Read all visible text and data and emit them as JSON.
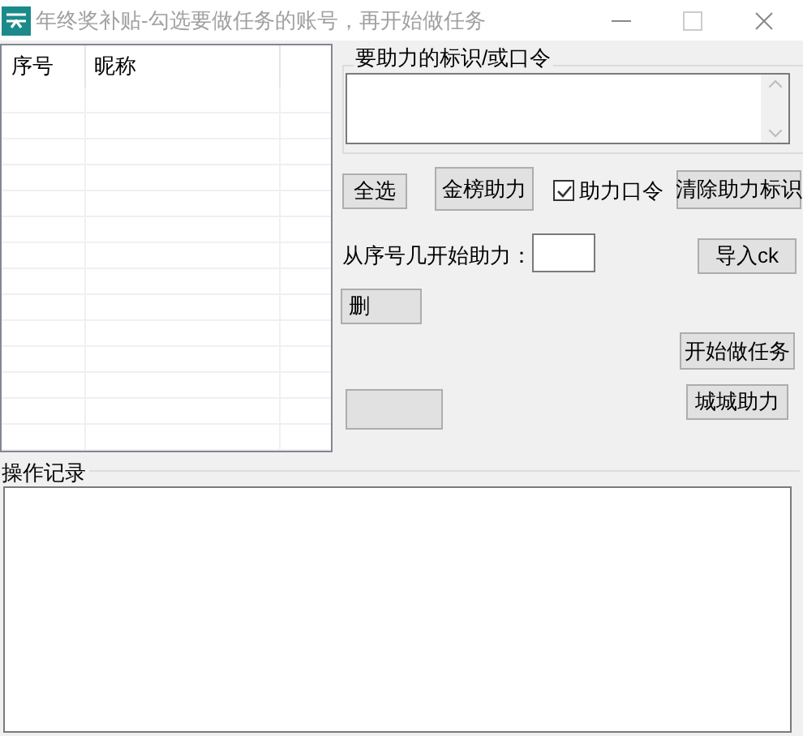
{
  "window": {
    "title": "年终奖补贴-勾选要做任务的账号，再开始做任务"
  },
  "account_list": {
    "columns": [
      "序号",
      "昵称"
    ]
  },
  "token_group": {
    "title": "要助力的标识/或口令"
  },
  "buttons_row": [
    {
      "kind": "button",
      "label": "全选"
    },
    {
      "kind": "button",
      "label": "金榜助力"
    },
    {
      "kind": "checkbox",
      "label": "助力口令",
      "checked": true
    },
    {
      "kind": "button",
      "label": "清除助力标识"
    }
  ],
  "start_index": {
    "label": "从序号几开始助力："
  },
  "import_button": "导入ck",
  "delete_button": "删",
  "start_button": "开始做任务",
  "city_button": "城城助力",
  "log": {
    "title": "操作记录"
  }
}
